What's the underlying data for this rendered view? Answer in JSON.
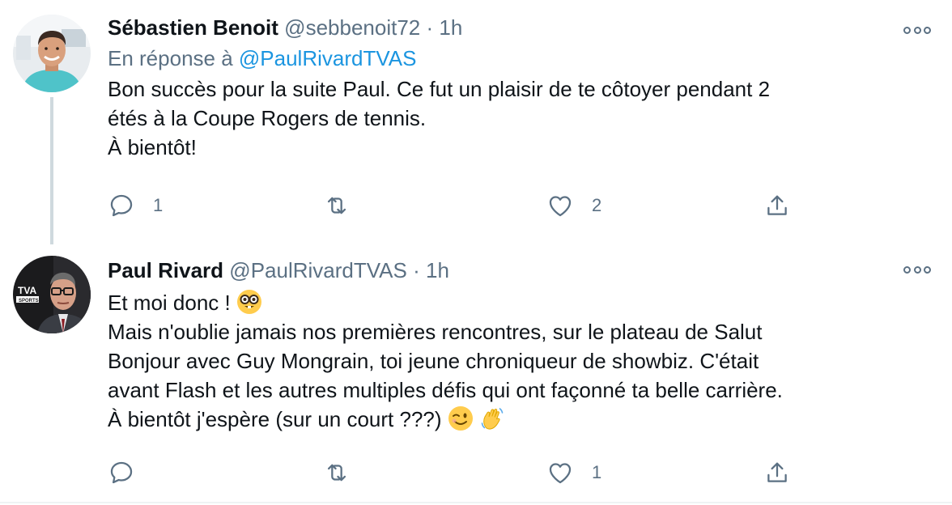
{
  "tweets": [
    {
      "name": "Sébastien Benoit",
      "handle": "@sebbenoit72",
      "separator": "·",
      "time": "1h",
      "reply_prefix": "En réponse à",
      "reply_mention": "@PaulRivardTVAS",
      "lines": [
        "Bon succès pour la suite Paul. Ce fut un plaisir de te côtoyer pendant 2",
        "étés à la Coupe Rogers de tennis.",
        "À bientôt!"
      ],
      "replies": "1",
      "retweets": "",
      "likes": "2"
    },
    {
      "name": "Paul Rivard",
      "handle": "@PaulRivardTVAS",
      "separator": "·",
      "time": "1h",
      "lines": [
        "Et moi donc !",
        "Mais n'oublie jamais nos premières rencontres, sur le plateau de Salut",
        "Bonjour avec Guy Mongrain, toi jeune chroniqueur de showbiz. C'était",
        "avant Flash et les autres multiples défis qui ont façonné ta belle carrière.",
        "À bientôt j'espère (sur un court ???)"
      ],
      "replies": "",
      "retweets": "",
      "likes": "1",
      "avatar_badge": "TVA",
      "avatar_badge_sub": "SPORTS"
    }
  ],
  "icons": {
    "reply": "comment-icon",
    "retweet": "retweet-icon",
    "like": "heart-icon",
    "share": "share-icon",
    "more": "more-icon",
    "emojis": [
      "nerd-face-emoji",
      "winking-face-emoji",
      "waving-hand-emoji"
    ]
  },
  "colors": {
    "text": "#0f1419",
    "secondary": "#5b7083",
    "link": "#1b95e0",
    "thread_line": "#cfd9de"
  }
}
